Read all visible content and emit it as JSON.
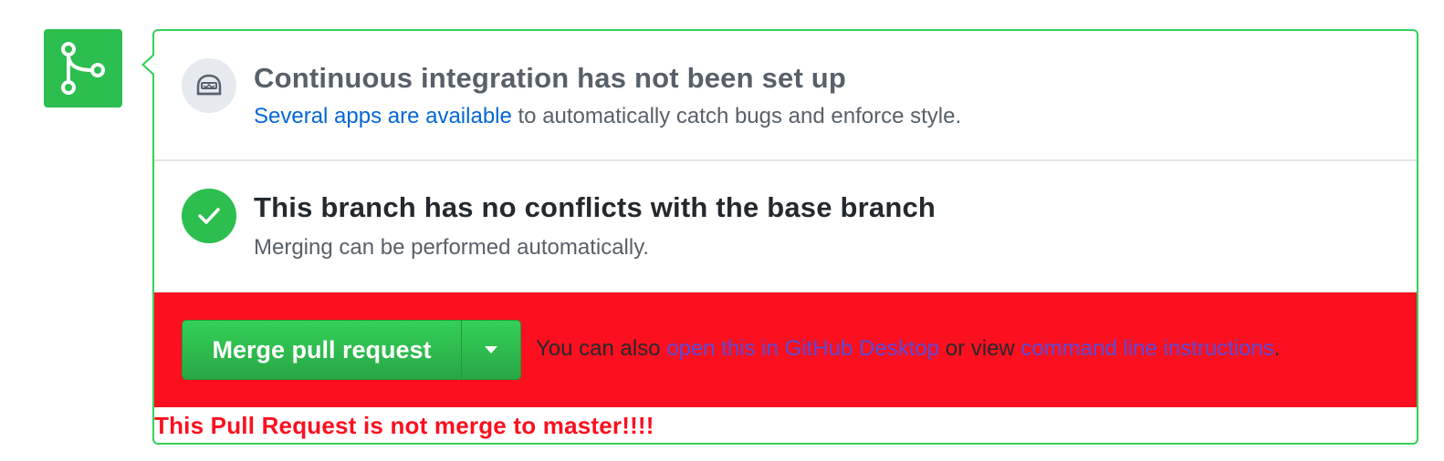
{
  "sidebar_icon": {
    "icon": "git-merge-icon",
    "color": "#2cbe4e"
  },
  "ci_status": {
    "icon": "ci-robot-icon",
    "title": "Continuous integration has not been set up",
    "link_text": "Several apps are available",
    "desc_rest": " to automatically catch bugs and enforce style."
  },
  "conflicts_status": {
    "icon": "check-icon",
    "title": "This branch has no conflicts with the base branch",
    "desc": "Merging can be performed automatically."
  },
  "merge": {
    "button_label": "Merge pull request",
    "dropdown_icon": "caret-down-icon",
    "hint_prefix": "You can also ",
    "desktop_link": "open this in GitHub Desktop",
    "hint_middle": " or view ",
    "cli_link": "command line instructions",
    "hint_suffix": ".",
    "background_color": "#fc0f1e"
  },
  "warning": {
    "text": "This Pull Request is not merge to master!!!!"
  }
}
